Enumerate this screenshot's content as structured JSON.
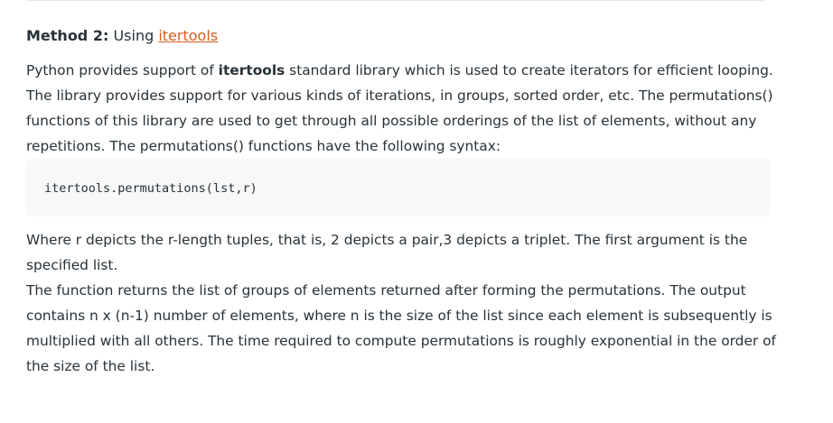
{
  "method": {
    "label": "Method 2:",
    "text_before_link": " Using ",
    "link_text": "itertools"
  },
  "para1": {
    "part1": "Python provides support of ",
    "bold": "itertools",
    "part2": " standard library which is used to create iterators for efficient looping. The library provides support for various kinds of iterations, in groups, sorted order, etc. The permutations() functions of this library are used to get through all possible orderings of the list of elements, without any repetitions. The permutations() functions have the following syntax:"
  },
  "code": {
    "text": "itertools.permutations(lst,r)"
  },
  "para2": {
    "text": "Where r depicts the r-length tuples, that is, 2 depicts a pair,3 depicts a triplet. The first argument is the specified list."
  },
  "para3": {
    "text": "The function returns the list of groups of elements returned after forming the permutations. The output contains n x (n-1) number of elements, where n is the size of the list since each element is subsequently is multiplied with all others. The time required to compute permutations is roughly exponential in the order of the size of the list."
  },
  "colors": {
    "text": "#273239",
    "link": "#d75b1a",
    "code_background": "#f8f8f8"
  }
}
